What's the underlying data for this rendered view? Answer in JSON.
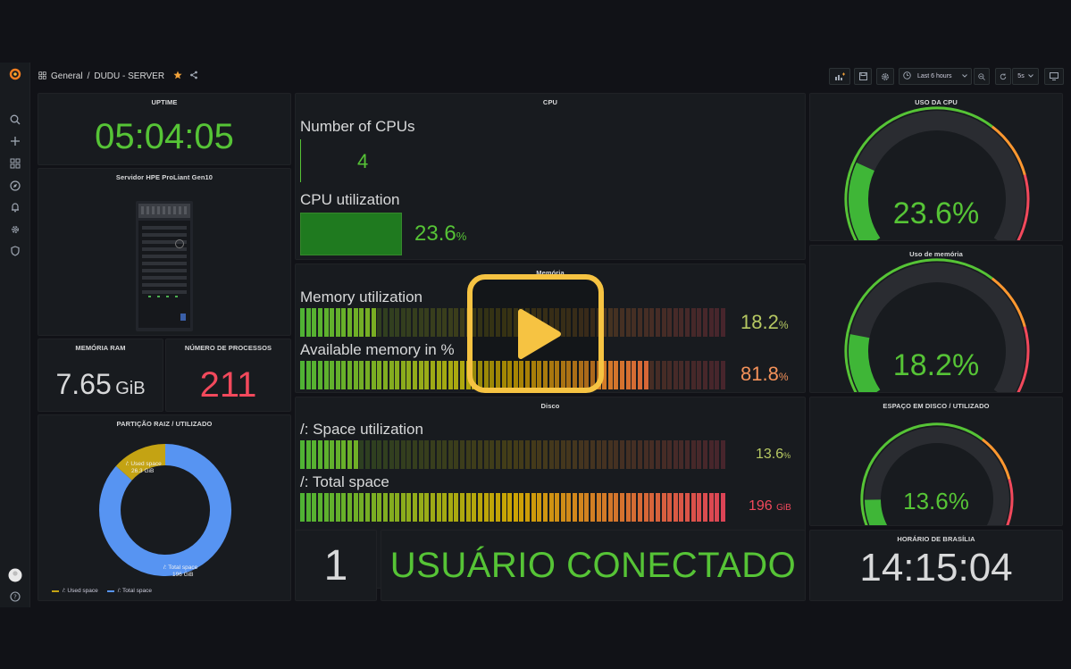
{
  "breadcrumb": {
    "folder": "General",
    "separator": "/",
    "dashboard": "DUDU - SERVER"
  },
  "toolbar": {
    "time_range": "Last 6 hours",
    "refresh": "5s"
  },
  "panels": {
    "uptime": {
      "title": "UPTIME",
      "value": "05:04:05"
    },
    "server": {
      "title": "Servidor HPE ProLiant Gen10"
    },
    "memoria_ram": {
      "title": "MEMÓRIA RAM",
      "value": "7.65",
      "unit": "GiB"
    },
    "processos": {
      "title": "NÚMERO DE PROCESSOS",
      "value": "211"
    },
    "particao": {
      "title": "PARTIÇÃO RAIZ / UTILIZADO",
      "used_label": "/: Used space",
      "used_value": "26.3 GiB",
      "total_label": "/: Total space",
      "total_value": "196 GiB",
      "legend_used": "/: Used space",
      "legend_total": "/: Total space"
    },
    "cpu": {
      "title": "CPU",
      "num_label": "Number of CPUs",
      "num_value": "4",
      "util_label": "CPU utilization",
      "util_value": "23.6",
      "util_unit": "%"
    },
    "memoria": {
      "title": "Memória",
      "util_label": "Memory utilization",
      "util_value": "18.2",
      "util_unit": "%",
      "avail_label": "Available memory in %",
      "avail_value": "81.8",
      "avail_unit": "%"
    },
    "disco": {
      "title": "Disco",
      "space_label": "/: Space utilization",
      "space_value": "13.6",
      "space_unit": "%",
      "total_label": "/: Total space",
      "total_value": "196",
      "total_unit": "GiB"
    },
    "usuarios": {
      "count": "1",
      "label": "USUÁRIO CONECTADO"
    },
    "uso_cpu": {
      "title": "USO DA CPU",
      "value": "23.6%"
    },
    "uso_memoria": {
      "title": "Uso de memória",
      "value": "18.2%"
    },
    "espaco_disco": {
      "title": "ESPAÇO EM DISCO / UTILIZADO",
      "value": "13.6%"
    },
    "horario": {
      "title": "HORÁRIO DE BRASÍLIA",
      "value": "14:15:04"
    }
  },
  "levels": {
    "cpu_util": 0.236,
    "mem_util": 0.182,
    "mem_avail": 0.818,
    "disk_util": 0.136,
    "disk_total": 1.0,
    "gauge_cpu": 0.236,
    "gauge_mem": 0.182,
    "gauge_disk": 0.136,
    "pie_used_fraction": 0.134
  },
  "colors": {
    "green": "#56c436",
    "red": "#f2495c",
    "orange": "#ff9830",
    "blue": "#5794f2",
    "yellow": "#c4a313",
    "play": "#f6c342"
  },
  "icons": [
    "grafana-logo-icon",
    "search-icon",
    "plus-icon",
    "dashboards-icon",
    "explore-icon",
    "alert-bell-icon",
    "gear-icon",
    "shield-icon",
    "avatar",
    "help-icon",
    "star-icon",
    "share-icon",
    "play-icon"
  ]
}
